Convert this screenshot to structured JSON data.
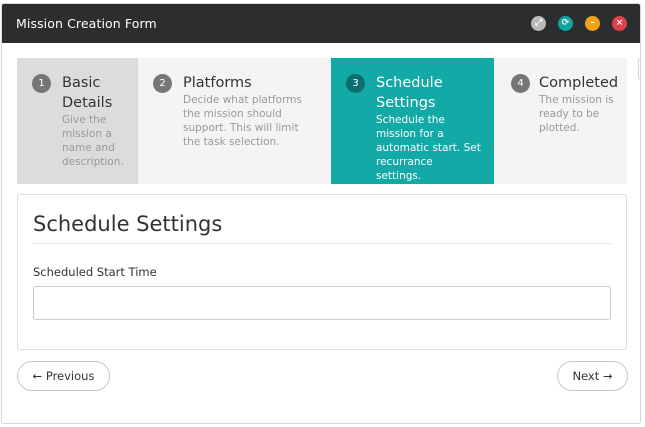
{
  "window": {
    "title": "Mission Creation Form",
    "controls": {
      "expand_icon": "expand-icon",
      "refresh_icon": "refresh-icon",
      "minimize_icon": "minimize-icon",
      "close_icon": "close-icon",
      "expand_glyph": "⤢",
      "refresh_glyph": "⟳",
      "minimize_glyph": "–",
      "close_glyph": "×"
    }
  },
  "steps": [
    {
      "number": "1",
      "title": "Basic Details",
      "description": "Give the mission a name and description.",
      "state": "done"
    },
    {
      "number": "2",
      "title": "Platforms",
      "description": "Decide what platforms the mission should support. This will limit the task selection.",
      "state": "pending"
    },
    {
      "number": "3",
      "title": "Schedule Settings",
      "description": "Schedule the mission for a automatic start. Set recurrance settings.",
      "state": "active"
    },
    {
      "number": "4",
      "title": "Completed",
      "description": "The mission is ready to be plotted.",
      "state": "pending"
    }
  ],
  "panel": {
    "title": "Schedule Settings",
    "start_time_label": "Scheduled Start Time",
    "start_time_value": ""
  },
  "navigation": {
    "previous_label": "← Previous",
    "next_label": "Next →"
  },
  "colors": {
    "titlebar": "#2c2d2f",
    "active_step": "#12a9a6",
    "completed_step": "#dcdcdc",
    "expand": "#b9b9b9",
    "refresh": "#12a59f",
    "minimize": "#f0a21a",
    "close": "#e0424c"
  }
}
